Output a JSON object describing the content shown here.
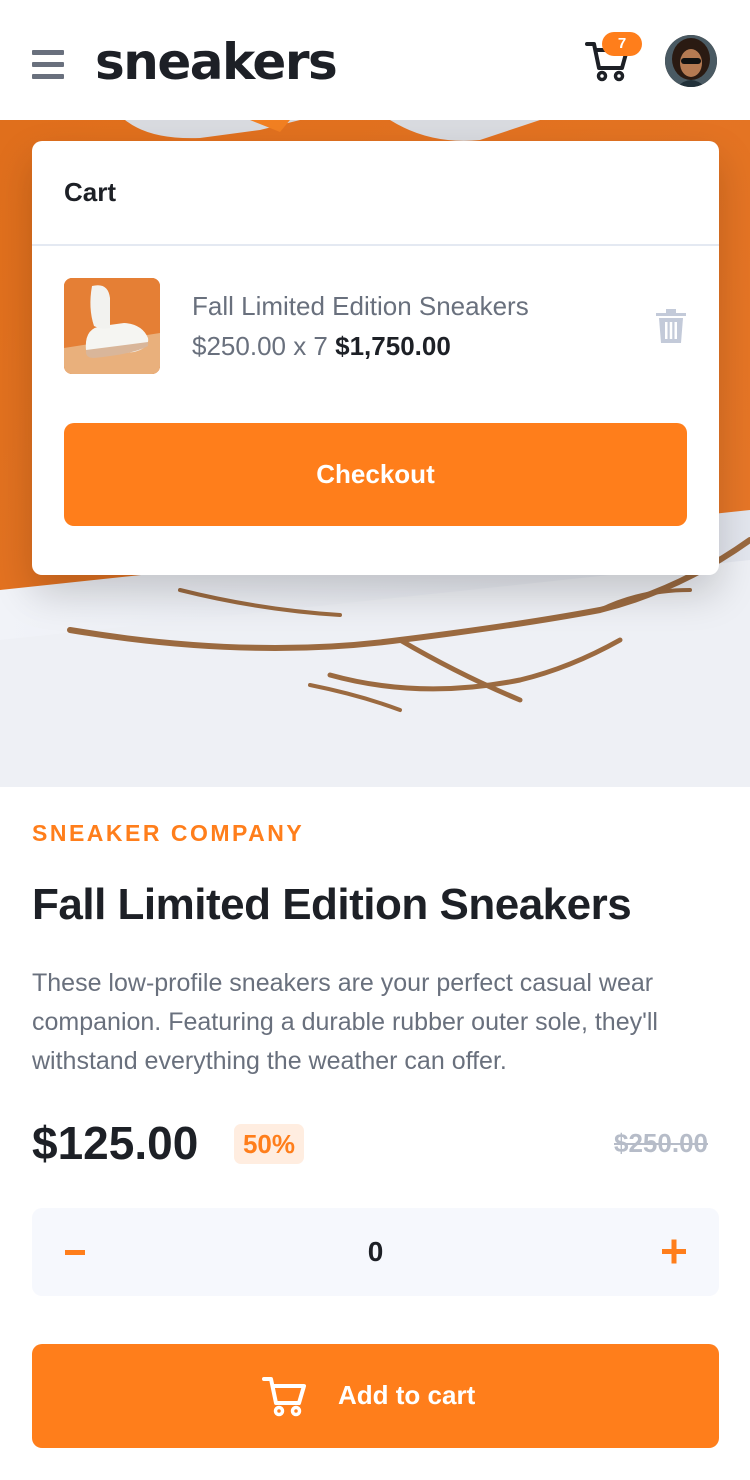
{
  "header": {
    "logo": "sneakers",
    "cart_count": "7"
  },
  "cart": {
    "title": "Cart",
    "item": {
      "name": "Fall Limited Edition Sneakers",
      "unit_price_qty": "$250.00 x 7 ",
      "total": "$1,750.00"
    },
    "checkout_label": "Checkout"
  },
  "product": {
    "company": "SNEAKER COMPANY",
    "title": "Fall Limited Edition Sneakers",
    "description": "These low-profile sneakers are your perfect casual wear companion. Featuring a durable rubber outer sole, they'll withstand everything the weather can offer.",
    "price": "$125.00",
    "discount": "50%",
    "old_price": "$250.00"
  },
  "quantity": {
    "value": "0"
  },
  "add_to_cart": {
    "label": "Add to cart"
  },
  "colors": {
    "accent": "#ff7e1b",
    "accent_pale": "#ffede0",
    "text_dark": "#1d2026",
    "text_gray": "#69707d",
    "muted": "#b6bcc8",
    "surface": "#f6f8fd"
  },
  "icons": {
    "menu": "menu-icon",
    "cart": "cart-icon",
    "delete": "trash-icon",
    "minus": "minus-icon",
    "plus": "plus-icon",
    "add_cart": "cart-icon"
  }
}
